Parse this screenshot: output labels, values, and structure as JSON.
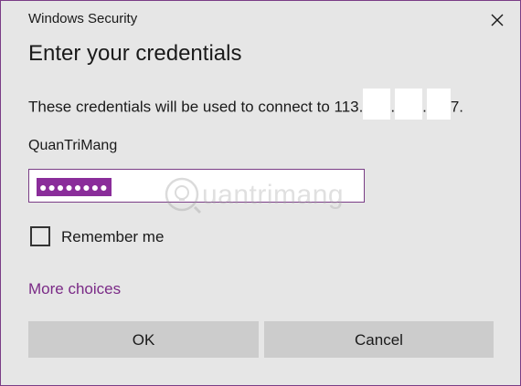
{
  "window": {
    "title": "Windows Security",
    "close_icon": "close-icon"
  },
  "dialog": {
    "heading": "Enter your credentials",
    "message_prefix": "These credentials will be used to connect to 113.",
    "message_mid1": ".",
    "message_mid2": ".",
    "message_suffix": "7."
  },
  "credentials": {
    "username": "QuanTriMang",
    "password_masked": "●●●●●●●●"
  },
  "options": {
    "remember_label": "Remember me",
    "remember_checked": false,
    "more_choices_label": "More choices"
  },
  "buttons": {
    "ok_label": "OK",
    "cancel_label": "Cancel"
  },
  "watermark": {
    "text": "uantrimang",
    "icon": "lightbulb-icon"
  },
  "colors": {
    "accent": "#7a2a86",
    "selection": "#8a2d9a",
    "button_bg": "#cccccc",
    "background": "#e6e6e6"
  }
}
